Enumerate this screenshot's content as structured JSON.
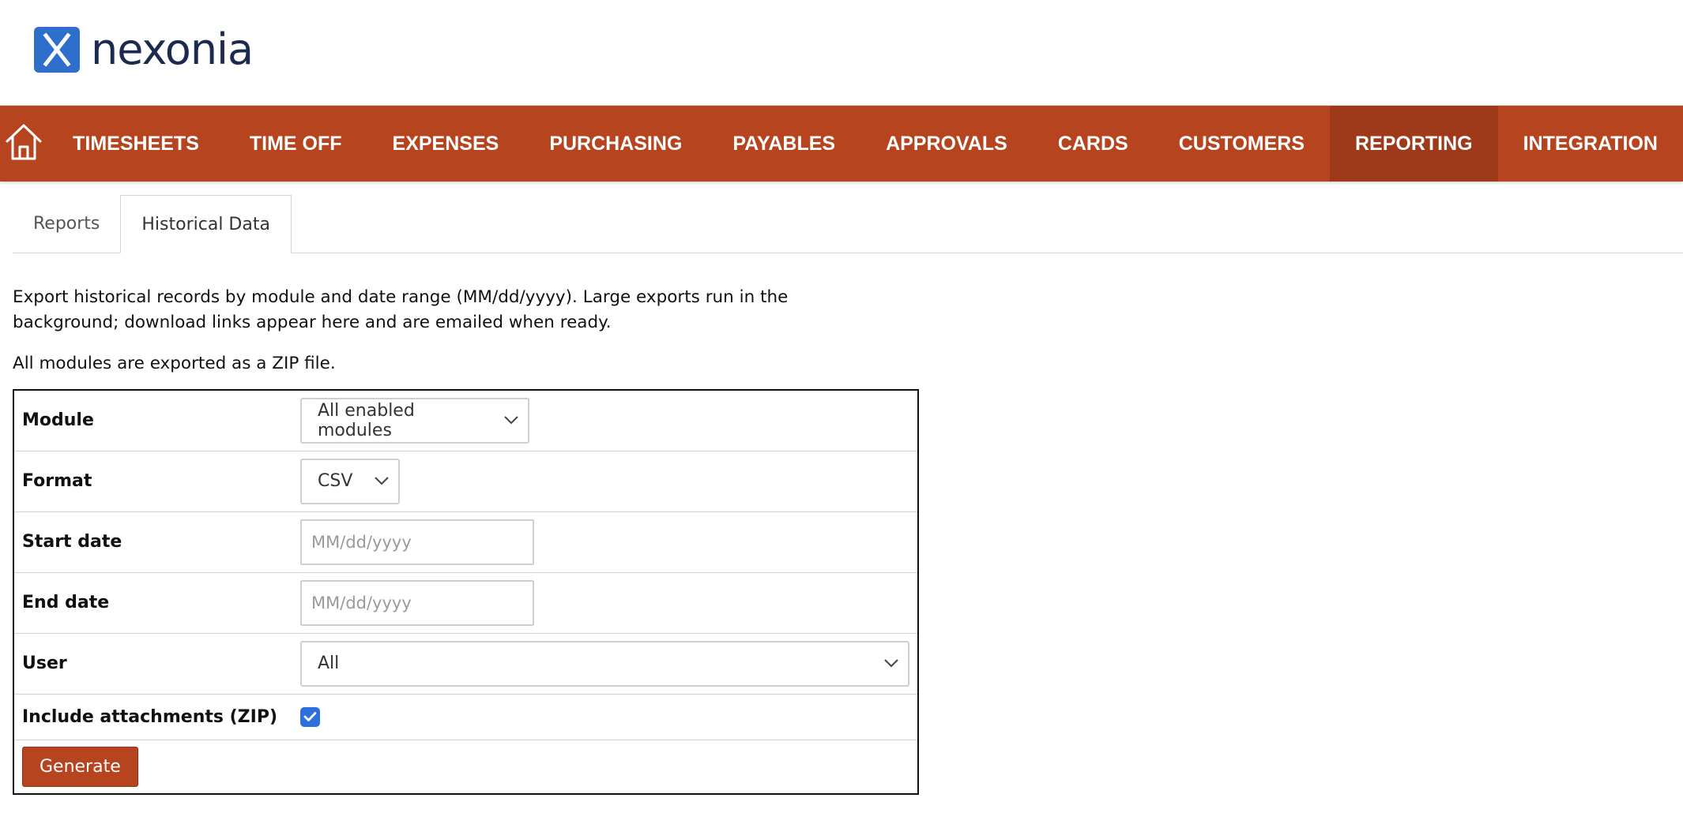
{
  "brand": {
    "name": "nexonia",
    "color": "#2f6fcb"
  },
  "nav": {
    "accent": "#b5441f",
    "active_accent": "#9e3a1a",
    "home_icon": "home-icon",
    "items": [
      "TIMESHEETS",
      "TIME OFF",
      "EXPENSES",
      "PURCHASING",
      "PAYABLES",
      "APPROVALS",
      "CARDS",
      "CUSTOMERS",
      "REPORTING",
      "INTEGRATION"
    ],
    "active": "REPORTING"
  },
  "tabs": {
    "items": [
      "Reports",
      "Historical Data"
    ],
    "active": "Historical Data"
  },
  "intro": {
    "line1": "Export historical records by module and date range (MM/dd/yyyy). Large exports run in the background; download links appear here and are emailed when ready.",
    "line2": "All modules are exported as a ZIP file."
  },
  "form": {
    "module": {
      "label": "Module",
      "value": "All enabled modules"
    },
    "format": {
      "label": "Format",
      "value": "CSV"
    },
    "start_date": {
      "label": "Start date",
      "placeholder": "MM/dd/yyyy"
    },
    "end_date": {
      "label": "End date",
      "placeholder": "MM/dd/yyyy"
    },
    "user": {
      "label": "User",
      "value": "All"
    },
    "attachments": {
      "label": "Include attachments (ZIP)",
      "checked": true
    },
    "generate_label": "Generate"
  }
}
